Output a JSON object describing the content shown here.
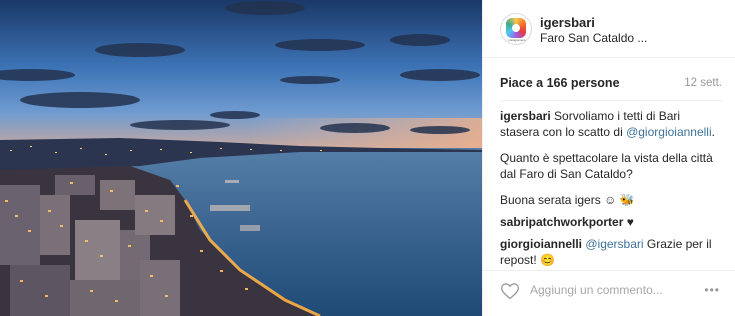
{
  "post": {
    "username": "igersbari",
    "location": "Faro San Cataldo ...",
    "avatar_caption": "instagramers",
    "likes": "Piace a 166 persone",
    "time": "12 sett.",
    "caption": {
      "author": "igersbari",
      "line1": "Sorvoliamo i tetti di Bari",
      "line2_prefix": "stasera con lo scatto di ",
      "line2_mention": "@giorgioiannelli",
      "line2_suffix": ".",
      "line3": "Quanto è spettacolare la vista della città",
      "line4": "dal Faro di San Cataldo?",
      "line5": "Buona serata igers ☺ 🐝"
    },
    "comments": [
      {
        "author": "sabripatchworkporter",
        "text": "♥"
      },
      {
        "author": "giorgioiannelli",
        "mention": "@igersbari",
        "text_line1": "Grazie per il",
        "text_line2": "repost! 😊"
      }
    ],
    "add_comment_placeholder": "Aggiungi un commento...",
    "more_label": "•••"
  },
  "colors": {
    "mention": "#3f729b",
    "sky_top": "#1c3a6b",
    "sea": "#2e5a86",
    "city_light": "#ffb347"
  }
}
